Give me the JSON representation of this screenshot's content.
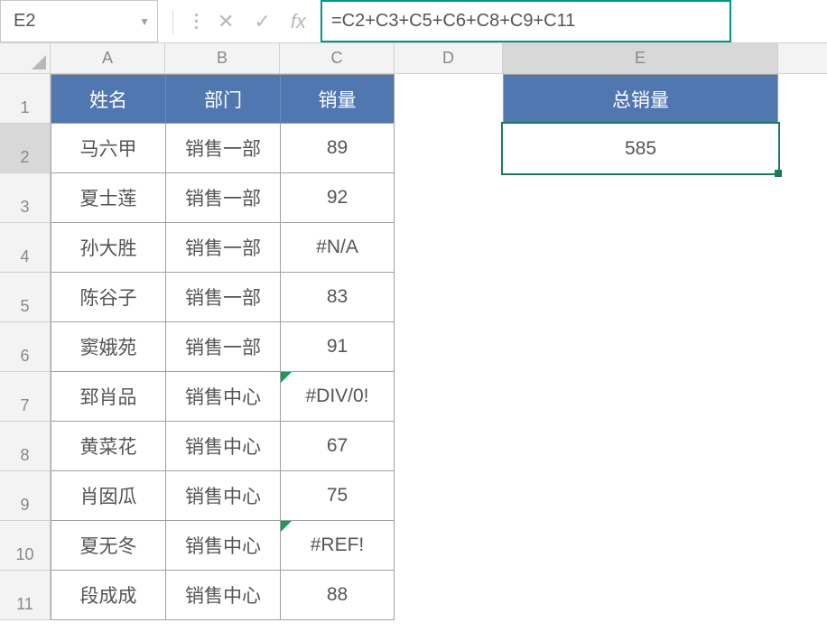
{
  "name_box": {
    "value": "E2"
  },
  "formula_bar": {
    "formula": "=C2+C3+C5+C6+C8+C9+C11"
  },
  "columns": [
    "A",
    "B",
    "C",
    "D",
    "E"
  ],
  "active_column": "E",
  "active_row": 2,
  "headers": {
    "name": "姓名",
    "dept": "部门",
    "sales": "销量",
    "total": "总销量"
  },
  "rows": [
    {
      "n": 1,
      "name": "马六甲",
      "dept": "销售一部",
      "sales": "89",
      "err": false
    },
    {
      "n": 2,
      "name": "夏士莲",
      "dept": "销售一部",
      "sales": "92",
      "err": false
    },
    {
      "n": 3,
      "name": "孙大胜",
      "dept": "销售一部",
      "sales": "#N/A",
      "err": false
    },
    {
      "n": 4,
      "name": "陈谷子",
      "dept": "销售一部",
      "sales": "83",
      "err": false
    },
    {
      "n": 5,
      "name": "窦娥苑",
      "dept": "销售一部",
      "sales": "91",
      "err": false
    },
    {
      "n": 6,
      "name": "郅肖品",
      "dept": "销售中心",
      "sales": "#DIV/0!",
      "err": true
    },
    {
      "n": 7,
      "name": "黄菜花",
      "dept": "销售中心",
      "sales": "67",
      "err": false
    },
    {
      "n": 8,
      "name": "肖囡瓜",
      "dept": "销售中心",
      "sales": "75",
      "err": false
    },
    {
      "n": 9,
      "name": "夏无冬",
      "dept": "销售中心",
      "sales": "#REF!",
      "err": true
    },
    {
      "n": 10,
      "name": "段成成",
      "dept": "销售中心",
      "sales": "88",
      "err": false
    }
  ],
  "total_value": "585",
  "icons": {
    "dropdown": "▼",
    "cancel": "✕",
    "enter": "✓",
    "fx": "fx"
  },
  "colors": {
    "accent": "#009688",
    "header_bg": "#5177b1",
    "selection": "#1a7a5c"
  }
}
